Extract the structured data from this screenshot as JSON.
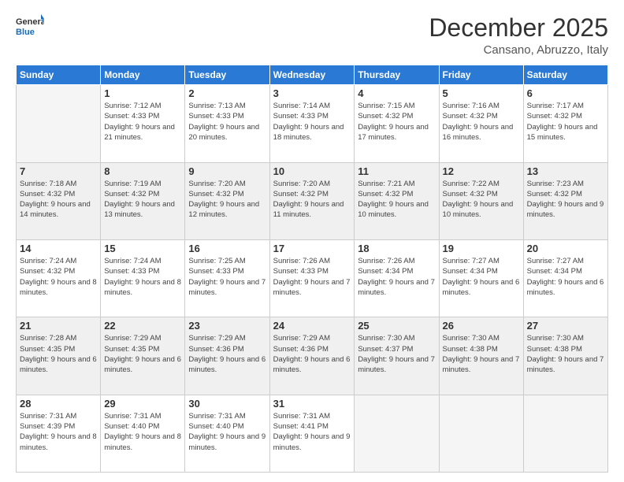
{
  "header": {
    "logo_general": "General",
    "logo_blue": "Blue",
    "month": "December 2025",
    "location": "Cansano, Abruzzo, Italy"
  },
  "days_of_week": [
    "Sunday",
    "Monday",
    "Tuesday",
    "Wednesday",
    "Thursday",
    "Friday",
    "Saturday"
  ],
  "weeks": [
    [
      {
        "num": "",
        "sunrise": "",
        "sunset": "",
        "daylight": ""
      },
      {
        "num": "1",
        "sunrise": "Sunrise: 7:12 AM",
        "sunset": "Sunset: 4:33 PM",
        "daylight": "Daylight: 9 hours and 21 minutes."
      },
      {
        "num": "2",
        "sunrise": "Sunrise: 7:13 AM",
        "sunset": "Sunset: 4:33 PM",
        "daylight": "Daylight: 9 hours and 20 minutes."
      },
      {
        "num": "3",
        "sunrise": "Sunrise: 7:14 AM",
        "sunset": "Sunset: 4:33 PM",
        "daylight": "Daylight: 9 hours and 18 minutes."
      },
      {
        "num": "4",
        "sunrise": "Sunrise: 7:15 AM",
        "sunset": "Sunset: 4:32 PM",
        "daylight": "Daylight: 9 hours and 17 minutes."
      },
      {
        "num": "5",
        "sunrise": "Sunrise: 7:16 AM",
        "sunset": "Sunset: 4:32 PM",
        "daylight": "Daylight: 9 hours and 16 minutes."
      },
      {
        "num": "6",
        "sunrise": "Sunrise: 7:17 AM",
        "sunset": "Sunset: 4:32 PM",
        "daylight": "Daylight: 9 hours and 15 minutes."
      }
    ],
    [
      {
        "num": "7",
        "sunrise": "Sunrise: 7:18 AM",
        "sunset": "Sunset: 4:32 PM",
        "daylight": "Daylight: 9 hours and 14 minutes."
      },
      {
        "num": "8",
        "sunrise": "Sunrise: 7:19 AM",
        "sunset": "Sunset: 4:32 PM",
        "daylight": "Daylight: 9 hours and 13 minutes."
      },
      {
        "num": "9",
        "sunrise": "Sunrise: 7:20 AM",
        "sunset": "Sunset: 4:32 PM",
        "daylight": "Daylight: 9 hours and 12 minutes."
      },
      {
        "num": "10",
        "sunrise": "Sunrise: 7:20 AM",
        "sunset": "Sunset: 4:32 PM",
        "daylight": "Daylight: 9 hours and 11 minutes."
      },
      {
        "num": "11",
        "sunrise": "Sunrise: 7:21 AM",
        "sunset": "Sunset: 4:32 PM",
        "daylight": "Daylight: 9 hours and 10 minutes."
      },
      {
        "num": "12",
        "sunrise": "Sunrise: 7:22 AM",
        "sunset": "Sunset: 4:32 PM",
        "daylight": "Daylight: 9 hours and 10 minutes."
      },
      {
        "num": "13",
        "sunrise": "Sunrise: 7:23 AM",
        "sunset": "Sunset: 4:32 PM",
        "daylight": "Daylight: 9 hours and 9 minutes."
      }
    ],
    [
      {
        "num": "14",
        "sunrise": "Sunrise: 7:24 AM",
        "sunset": "Sunset: 4:32 PM",
        "daylight": "Daylight: 9 hours and 8 minutes."
      },
      {
        "num": "15",
        "sunrise": "Sunrise: 7:24 AM",
        "sunset": "Sunset: 4:33 PM",
        "daylight": "Daylight: 9 hours and 8 minutes."
      },
      {
        "num": "16",
        "sunrise": "Sunrise: 7:25 AM",
        "sunset": "Sunset: 4:33 PM",
        "daylight": "Daylight: 9 hours and 7 minutes."
      },
      {
        "num": "17",
        "sunrise": "Sunrise: 7:26 AM",
        "sunset": "Sunset: 4:33 PM",
        "daylight": "Daylight: 9 hours and 7 minutes."
      },
      {
        "num": "18",
        "sunrise": "Sunrise: 7:26 AM",
        "sunset": "Sunset: 4:34 PM",
        "daylight": "Daylight: 9 hours and 7 minutes."
      },
      {
        "num": "19",
        "sunrise": "Sunrise: 7:27 AM",
        "sunset": "Sunset: 4:34 PM",
        "daylight": "Daylight: 9 hours and 6 minutes."
      },
      {
        "num": "20",
        "sunrise": "Sunrise: 7:27 AM",
        "sunset": "Sunset: 4:34 PM",
        "daylight": "Daylight: 9 hours and 6 minutes."
      }
    ],
    [
      {
        "num": "21",
        "sunrise": "Sunrise: 7:28 AM",
        "sunset": "Sunset: 4:35 PM",
        "daylight": "Daylight: 9 hours and 6 minutes."
      },
      {
        "num": "22",
        "sunrise": "Sunrise: 7:29 AM",
        "sunset": "Sunset: 4:35 PM",
        "daylight": "Daylight: 9 hours and 6 minutes."
      },
      {
        "num": "23",
        "sunrise": "Sunrise: 7:29 AM",
        "sunset": "Sunset: 4:36 PM",
        "daylight": "Daylight: 9 hours and 6 minutes."
      },
      {
        "num": "24",
        "sunrise": "Sunrise: 7:29 AM",
        "sunset": "Sunset: 4:36 PM",
        "daylight": "Daylight: 9 hours and 6 minutes."
      },
      {
        "num": "25",
        "sunrise": "Sunrise: 7:30 AM",
        "sunset": "Sunset: 4:37 PM",
        "daylight": "Daylight: 9 hours and 7 minutes."
      },
      {
        "num": "26",
        "sunrise": "Sunrise: 7:30 AM",
        "sunset": "Sunset: 4:38 PM",
        "daylight": "Daylight: 9 hours and 7 minutes."
      },
      {
        "num": "27",
        "sunrise": "Sunrise: 7:30 AM",
        "sunset": "Sunset: 4:38 PM",
        "daylight": "Daylight: 9 hours and 7 minutes."
      }
    ],
    [
      {
        "num": "28",
        "sunrise": "Sunrise: 7:31 AM",
        "sunset": "Sunset: 4:39 PM",
        "daylight": "Daylight: 9 hours and 8 minutes."
      },
      {
        "num": "29",
        "sunrise": "Sunrise: 7:31 AM",
        "sunset": "Sunset: 4:40 PM",
        "daylight": "Daylight: 9 hours and 8 minutes."
      },
      {
        "num": "30",
        "sunrise": "Sunrise: 7:31 AM",
        "sunset": "Sunset: 4:40 PM",
        "daylight": "Daylight: 9 hours and 9 minutes."
      },
      {
        "num": "31",
        "sunrise": "Sunrise: 7:31 AM",
        "sunset": "Sunset: 4:41 PM",
        "daylight": "Daylight: 9 hours and 9 minutes."
      },
      {
        "num": "",
        "sunrise": "",
        "sunset": "",
        "daylight": ""
      },
      {
        "num": "",
        "sunrise": "",
        "sunset": "",
        "daylight": ""
      },
      {
        "num": "",
        "sunrise": "",
        "sunset": "",
        "daylight": ""
      }
    ]
  ]
}
